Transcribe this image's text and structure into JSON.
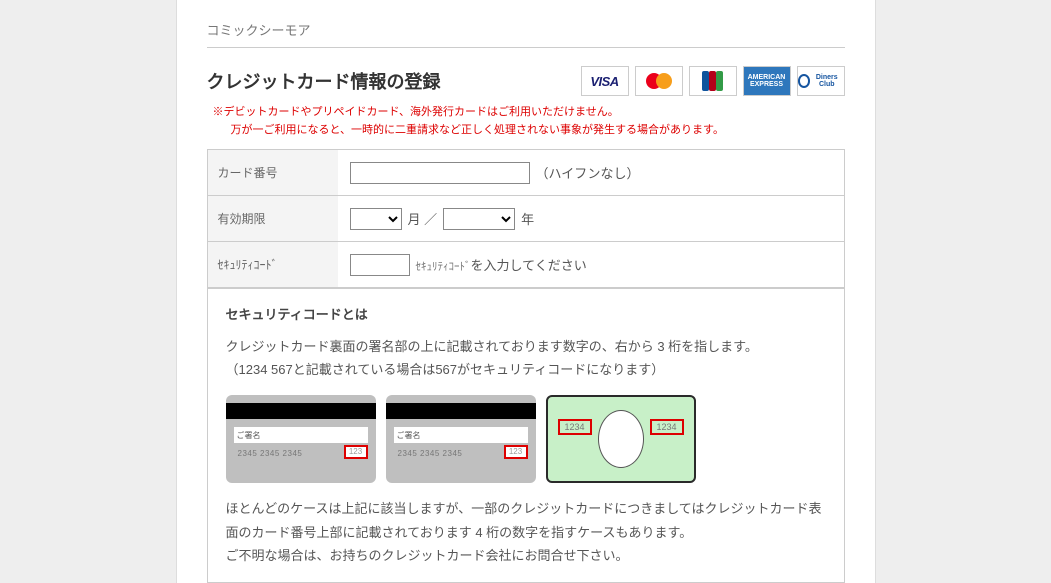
{
  "site": {
    "name": "コミックシーモア"
  },
  "heading": "クレジットカード情報の登録",
  "warning": {
    "line1": "※デビットカードやプリペイドカード、海外発行カードはご利用いただけません。",
    "line2": "万が一ご利用になると、一時的に二重請求など正しく処理されない事象が発生する場合があります。"
  },
  "form": {
    "card_number": {
      "label": "カード番号",
      "hint": "（ハイフンなし）"
    },
    "expiry": {
      "label": "有効期限",
      "month_suffix": "月 ／",
      "year_suffix": "年"
    },
    "security": {
      "label": "ｾｷｭﾘﾃｨｺｰﾄﾞ",
      "hint_prefix": "ｾｷｭﾘﾃｨｺｰﾄﾞ",
      "hint_suffix": "を入力してください"
    }
  },
  "info": {
    "title": "セキュリティコードとは",
    "desc": "クレジットカード裏面の署名部の上に記載されております数字の、右から 3 桁を指します。",
    "example": "（1234 567と記載されている場合は567がセキュリティコードになります）",
    "diagram": {
      "signature_label": "ご署名",
      "digits_sample": "2345 2345 2345",
      "back_code": "123",
      "front_code": "1234"
    },
    "note": "ほとんどのケースは上記に該当しますが、一部のクレジットカードにつきましてはクレジットカード表面のカード番号上部に記載されております 4 桁の数字を指すケースもあります。",
    "note2": "ご不明な場合は、お持ちのクレジットカード会社にお問合せ下さい。"
  },
  "logos": {
    "visa": "VISA",
    "amex": "AMERICAN EXPRESS",
    "diners": "Diners Club"
  }
}
